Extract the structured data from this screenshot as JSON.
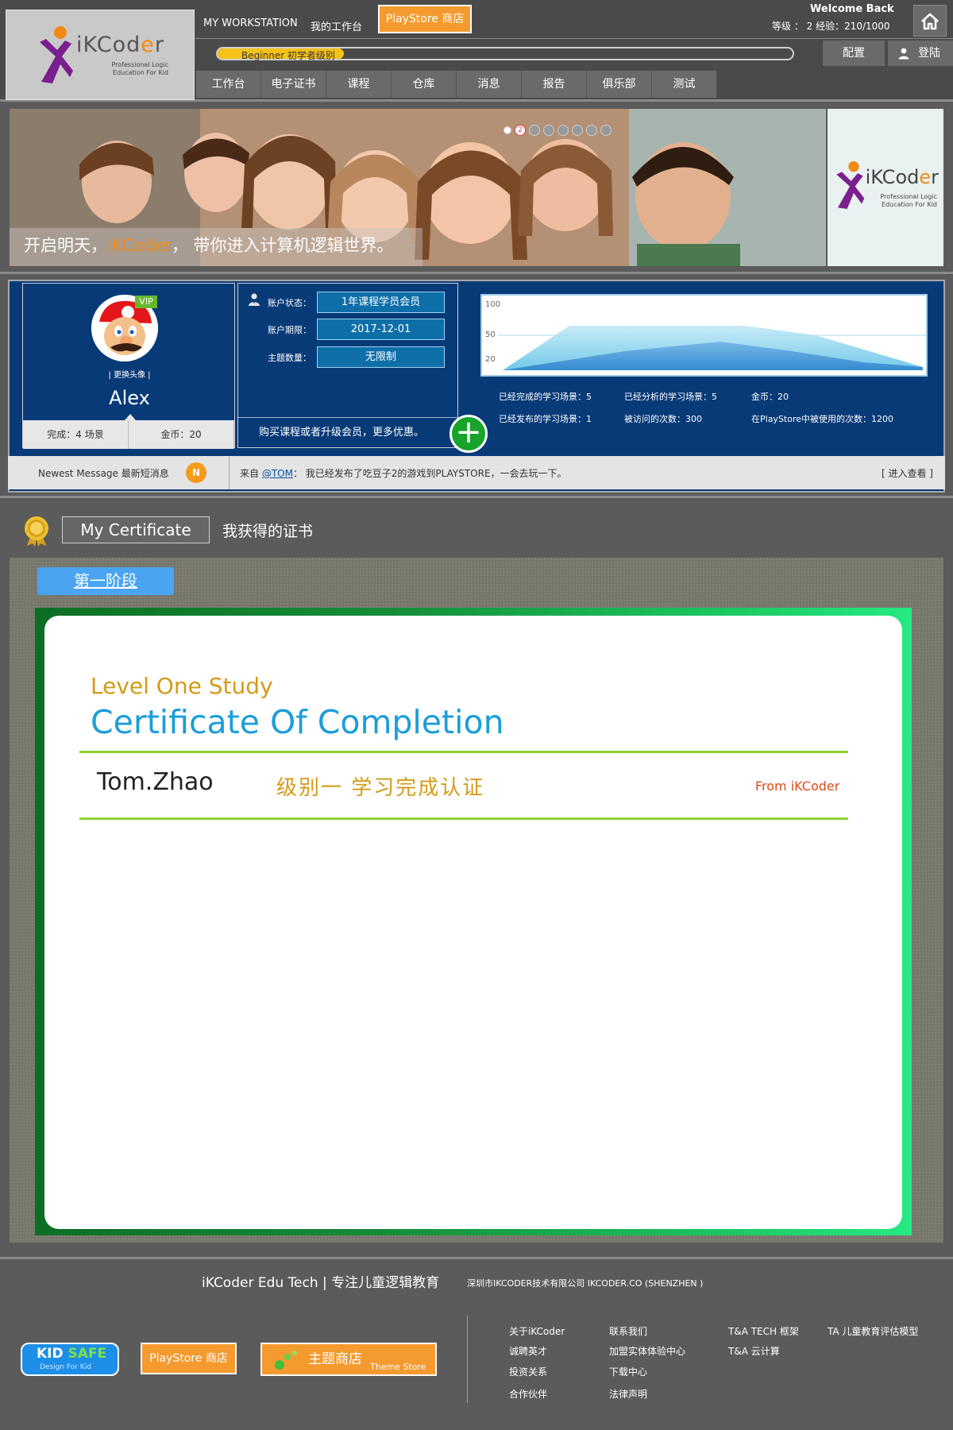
{
  "brand": {
    "name_prefix": "iKC",
    "name_o": "o",
    "name_d": "d",
    "name_e": "e",
    "name_suffix": "r",
    "tagline_line1": "Professional Logic",
    "tagline_line2": "Education For Kid"
  },
  "header": {
    "workstation_en": "MY WORKSTATION",
    "workstation_cn": "我的工作台",
    "playstore_label": "PlayStore 商店",
    "welcome": "Welcome Back",
    "level_exp": "等级 ： 2  经验：210/1000",
    "progress_label": "Beginner 初学者级别",
    "progress_fraction": 0.21,
    "config_label": "配置",
    "login_label": "登陆"
  },
  "nav": {
    "tabs": [
      {
        "label": "工作台"
      },
      {
        "label": "电子证书"
      },
      {
        "label": "课程"
      },
      {
        "label": "仓库"
      },
      {
        "label": "消息"
      },
      {
        "label": "报告"
      },
      {
        "label": "俱乐部"
      },
      {
        "label": "测试"
      }
    ]
  },
  "banner": {
    "caption_before": "开启明天，",
    "caption_brand": "iKCoder",
    "caption_after": "， 带你进入计算机逻辑世界。",
    "active_dot": "2"
  },
  "profile": {
    "vip_label": "VIP",
    "change_avatar": "| 更换头像 |",
    "user_name": "Alex",
    "completed": "完成：4 场景",
    "coins": "金币：20"
  },
  "account": {
    "status_label": "账户状态：",
    "status_value": "1年课程学员会员",
    "expiry_label": "账户期限：",
    "expiry_value": "2017-12-01",
    "themes_label": "主题数量：",
    "themes_value": "无限制",
    "buy_text": "购买课程或者升级会员，更多优惠。",
    "plus_label": "+"
  },
  "stats": {
    "chart_ticks": [
      "100",
      "50",
      "20"
    ],
    "completed_scenes": "已经完成的学习场景：5",
    "analyzed_scenes": "已经分析的学习场景：5",
    "coins": "金币：20",
    "published_scenes": "已经发布的学习场景：1",
    "visits": "被访问的次数：300",
    "playstore_uses": "在PlayStore中被使用的次数：1200"
  },
  "message": {
    "title": "Newest Message 最新短消息",
    "badge": "N",
    "from_prefix": "来自",
    "from_user": "@TOM",
    "from_text": "：  我已经发布了吃豆子2的游戏到PLAYSTORE，一会去玩一下。",
    "more": "[ 进入查看 ]"
  },
  "certificate": {
    "section_en": "My Certificate",
    "section_cn": "我获得的证书",
    "stage_label": "第一阶段",
    "level_text": "Level One Study",
    "heading": "Certificate Of Completion",
    "holder": "Tom.Zhao",
    "description": "级别一  学习完成认证",
    "from": "From iKCoder"
  },
  "footer": {
    "brand_line": "iKCoder Edu Tech | 专注儿童逻辑教育",
    "company": "深圳市IKCODER技术有限公司 IKCODER.CO (SHENZHEN )",
    "kidsafe_kid": "KID",
    "kidsafe_safe": "SAFE",
    "kidsafe_sub": "Design For Kid",
    "playstore_label": "PlayStore 商店",
    "theme_cn": "主题商店",
    "theme_en": "Theme Store",
    "links": {
      "about": "关于iKCoder",
      "contact": "联系我们",
      "ta_tech": "T&A TECH 框架",
      "ta_model": "TA 儿童教育评估模型",
      "jobs": "诚聘英才",
      "franchise": "加盟实体体验中心",
      "ta_cloud": "T&A 云计算",
      "investor": "投资关系",
      "download": "下载中心",
      "partners": "合作伙伴",
      "legal": "法律声明"
    }
  },
  "colors": {
    "accent_orange": "#f49a2e",
    "panel_blue": "#083a78",
    "cert_green": "#168d38",
    "cert_blue": "#1b9ed8",
    "cert_gold": "#d39b16"
  }
}
